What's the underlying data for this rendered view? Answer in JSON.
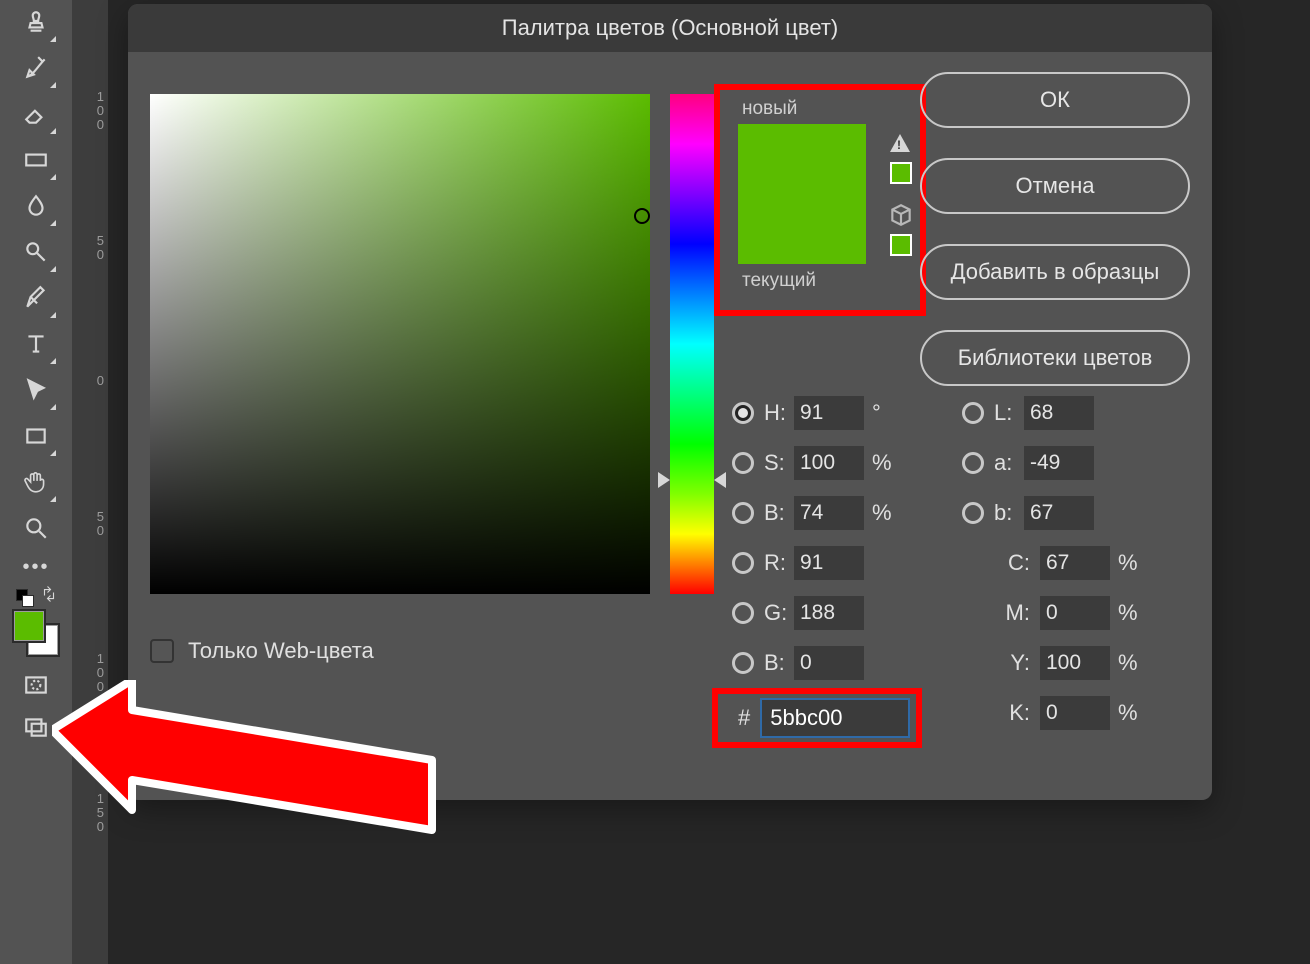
{
  "dialog": {
    "title": "Палитра цветов (Основной цвет)",
    "ok": "ОК",
    "cancel": "Отмена",
    "add_swatch": "Добавить в образцы",
    "libraries": "Библиотеки цветов",
    "web_only": "Только Web-цвета",
    "new_label": "новый",
    "current_label": "текущий"
  },
  "hsb": {
    "h": "91",
    "h_unit": "°",
    "s": "100",
    "s_unit": "%",
    "b": "74",
    "b_unit": "%"
  },
  "lab": {
    "l": "68",
    "a": "-49",
    "b": "67"
  },
  "rgb": {
    "r": "91",
    "g": "188",
    "b": "0"
  },
  "cmyk": {
    "c": "67",
    "m": "0",
    "y": "100",
    "k": "0",
    "unit": "%"
  },
  "hex": "5bbc00",
  "color": {
    "new_hex": "#5bbc00",
    "current_hex": "#5bbc00",
    "swatch_fg": "#5bbc00",
    "swatch_bg": "#ffffff"
  },
  "labels": {
    "H": "H:",
    "S": "S:",
    "B": "B:",
    "L": "L:",
    "a": "a:",
    "b2": "b:",
    "R": "R:",
    "G": "G:",
    "Bc": "B:",
    "C": "C:",
    "M": "M:",
    "Y": "Y:",
    "K": "K:",
    "hash": "#"
  },
  "ruler": {
    "t1": "100",
    "t2": "50",
    "t3": "0",
    "t4": "50",
    "t5": "100",
    "t6": "150"
  }
}
